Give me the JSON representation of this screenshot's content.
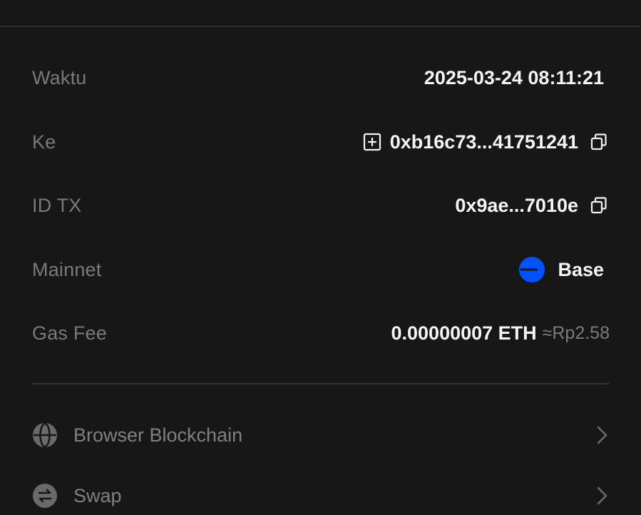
{
  "details": {
    "time": {
      "label": "Waktu",
      "value": "2025-03-24 08:11:21"
    },
    "to": {
      "label": "Ke",
      "value": "0xb16c73...41751241"
    },
    "tx_id": {
      "label": "ID TX",
      "value": "0x9ae...7010e"
    },
    "mainnet": {
      "label": "Mainnet",
      "value": "Base",
      "icon_color": "#0052ff"
    },
    "gas_fee": {
      "label": "Gas Fee",
      "value": "0.00000007 ETH",
      "fiat": "≈Rp2.58"
    }
  },
  "links": [
    {
      "label": "Browser Blockchain",
      "icon": "globe-icon"
    },
    {
      "label": "Swap",
      "icon": "swap-icon"
    }
  ],
  "colors": {
    "background": "#171717",
    "label": "#7a7a7a",
    "value": "#f4f4f4",
    "base_blue": "#0052ff"
  }
}
